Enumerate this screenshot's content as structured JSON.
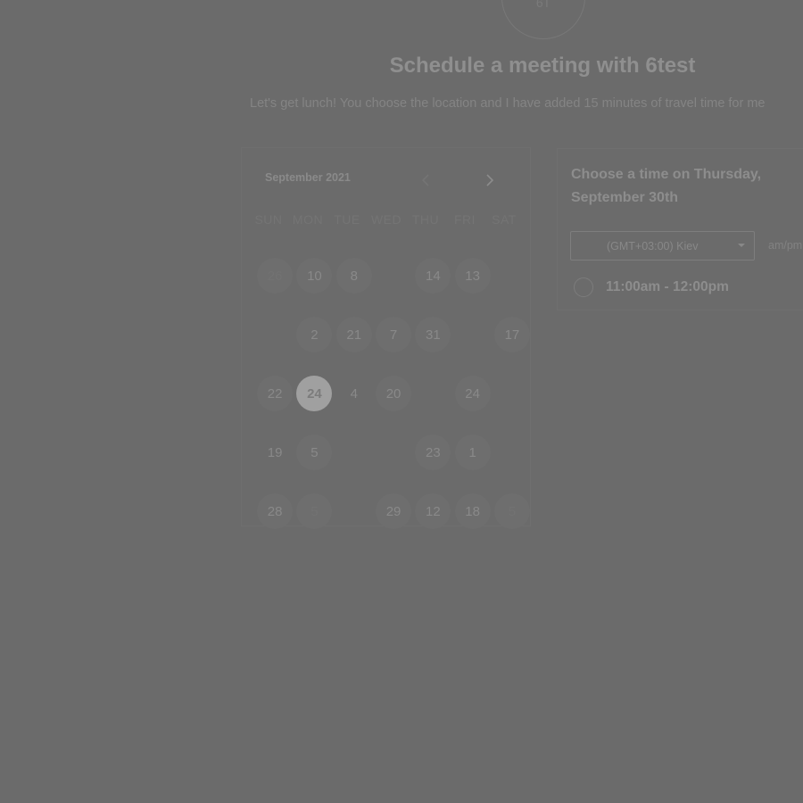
{
  "profile": {
    "avatar_initials": "6T"
  },
  "header": {
    "title": "Schedule a meeting with 6test",
    "subtitle": "Let's get lunch! You choose the location and I have added 15 minutes of travel time for me"
  },
  "calendar": {
    "month_label": "September 2021",
    "prev_icon": "chevron-left-icon",
    "next_icon": "chevron-right-icon",
    "weekdays": [
      "SUN",
      "MON",
      "TUE",
      "WED",
      "THU",
      "FRI",
      "SAT"
    ],
    "days": [
      "26",
      "10",
      "8",
      "",
      "14",
      "13",
      "",
      "",
      "2",
      "21",
      "7",
      "31",
      "",
      "17",
      "22",
      "24",
      "4",
      "20",
      "",
      "24",
      "",
      "19",
      "5",
      "",
      "",
      "23",
      "1",
      "",
      "28",
      "5",
      "",
      "29",
      "12",
      "18",
      "5"
    ],
    "selected_day": "24"
  },
  "time_panel": {
    "heading": "Choose a time on Thursday, September 30th",
    "timezone": "(GMT+03:00) Kiev",
    "ampm": "am/pm",
    "slots": [
      "11:00am - 12:00pm"
    ]
  },
  "colors": {
    "overlay": "#6b6b6b",
    "selected_day_bg": "#a0a0a0"
  }
}
